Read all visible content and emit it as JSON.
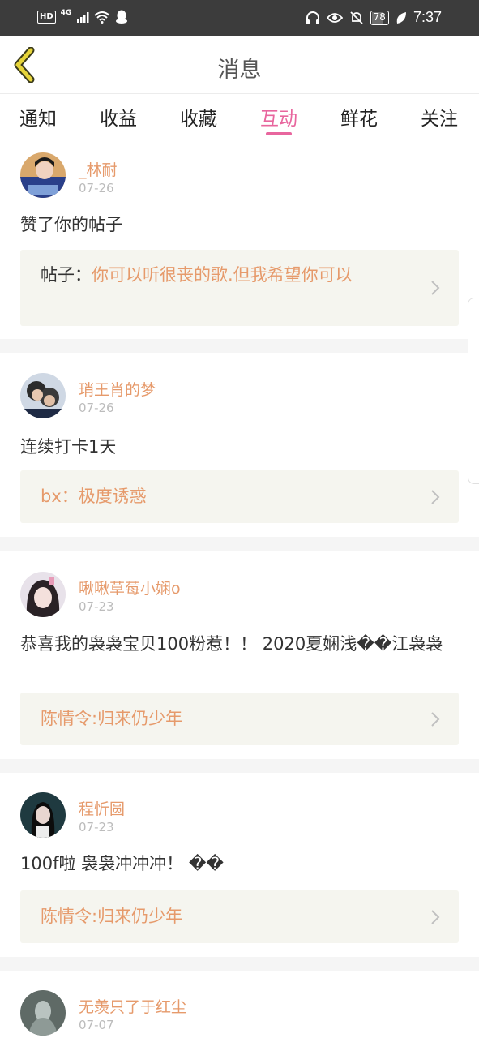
{
  "status_bar": {
    "network_badge": "HD",
    "network_type": "4G",
    "battery": "78",
    "time": "7:37"
  },
  "header": {
    "title": "消息"
  },
  "tabs": [
    {
      "label": "通知"
    },
    {
      "label": "收益"
    },
    {
      "label": "收藏"
    },
    {
      "label": "互动",
      "active": true
    },
    {
      "label": "鲜花"
    },
    {
      "label": "关注"
    }
  ],
  "colors": {
    "accent": "#e8669e",
    "username": "#e69a6b",
    "date": "#bcbcbc",
    "ref_background": "#f5f5ef",
    "status_bar": "#3c3c3c",
    "back_arrow": "#e6d43a"
  },
  "feed": [
    {
      "user": "_林耐",
      "date": "07-26",
      "message": "赞了你的帖子",
      "ref_prefix": "帖子：",
      "ref": "你可以听很丧的歌.但我希望你可以",
      "avatar_icon": "avatar-photo"
    },
    {
      "user": "琑王肖的梦",
      "date": "07-26",
      "message": "连续打卡1天",
      "ref_prefix": "",
      "ref": "bx：极度诱惑",
      "avatar_icon": "avatar-photo"
    },
    {
      "user": "啾啾草莓小娴o",
      "date": "07-23",
      "message": "恭喜我的袅袅宝贝100粉惹！！ 2020夏娴浅��江袅袅",
      "ref_prefix": "",
      "ref": "陈情令:归来仍少年",
      "avatar_icon": "avatar-photo"
    },
    {
      "user": "程忻圆",
      "date": "07-23",
      "message": "100f啦 袅袅冲冲冲！ ��",
      "ref_prefix": "",
      "ref": "陈情令:归来仍少年",
      "avatar_icon": "avatar-photo"
    },
    {
      "user": "无羡只了于红尘",
      "date": "07-07",
      "avatar_icon": "avatar-photo"
    }
  ]
}
